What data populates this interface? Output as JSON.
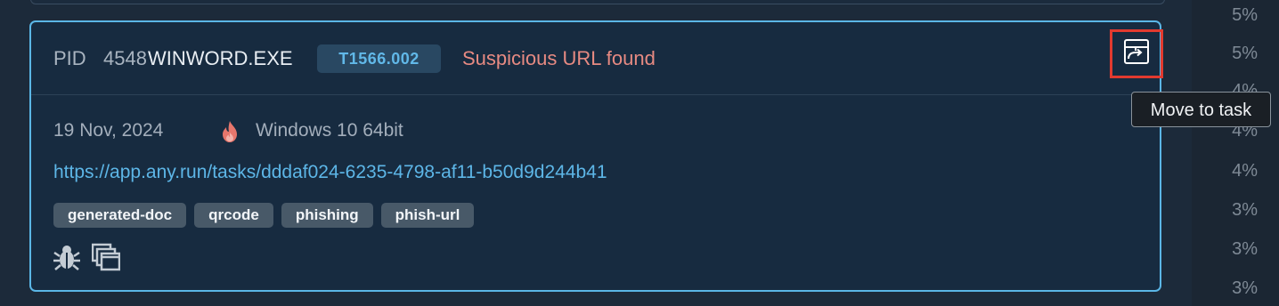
{
  "card": {
    "pid_label": "PID",
    "pid_value": "4548",
    "process": "WINWORD.EXE",
    "technique": "T1566.002",
    "alert": "Suspicious URL found",
    "date": "19 Nov, 2024",
    "os": "Windows 10 64bit",
    "url": "https://app.any.run/tasks/dddaf024-6235-4798-af11-b50d9d244b41",
    "tags": [
      "generated-doc",
      "qrcode",
      "phishing",
      "phish-url"
    ],
    "action_icons": [
      "bug-icon",
      "windows-icon"
    ],
    "move_icon": "move-to-task-icon",
    "flame_icon": "flame-icon"
  },
  "tooltip": "Move to task",
  "percentages": [
    "5%",
    "5%",
    "4%",
    "4%",
    "4%",
    "3%",
    "3%",
    "3%"
  ],
  "colors": {
    "background": "#1c2a3a",
    "card": "#172b40",
    "card_border": "#5bb6e6",
    "alert": "#e78a82",
    "link": "#5db6e7",
    "highlight": "#e23a2f"
  }
}
